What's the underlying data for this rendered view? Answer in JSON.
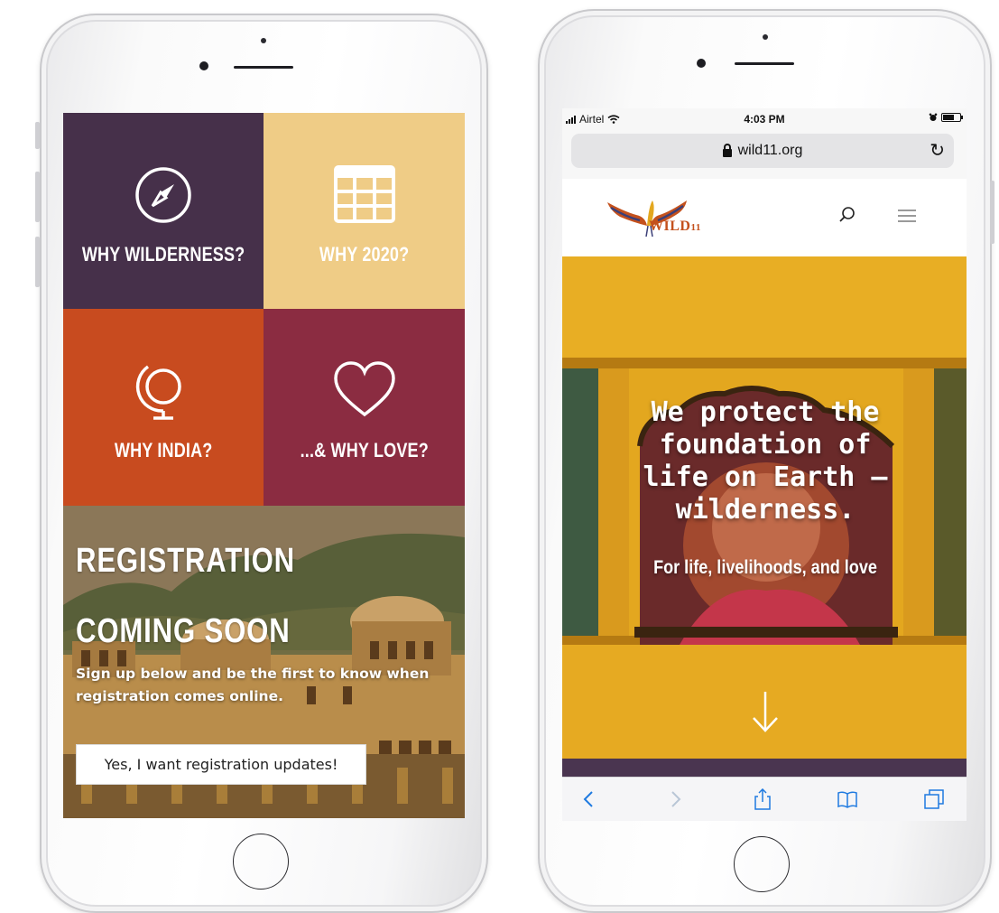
{
  "left_phone": {
    "tiles": [
      {
        "label": "WHY WILDERNESS?",
        "icon": "compass-icon",
        "color": "#46304a"
      },
      {
        "label": "WHY 2020?",
        "icon": "calendar-grid-icon",
        "color": "#efcc86"
      },
      {
        "label": "WHY INDIA?",
        "icon": "globe-icon",
        "color": "#c84b1f"
      },
      {
        "label": "...& WHY LOVE?",
        "icon": "heart-icon",
        "color": "#8b2c41"
      }
    ],
    "registration": {
      "title": "REGISTRATION COMING SOON",
      "subtitle": "Sign up below and be the first to know when registration comes online.",
      "button_label": "Yes, I want registration updates!"
    }
  },
  "right_phone": {
    "status_bar": {
      "carrier": "Airtel",
      "time": "4:03 PM"
    },
    "url": "wild11.org",
    "logo_text": "WILD",
    "logo_suffix": "11",
    "hero": {
      "title": "We protect the foundation of life on Earth – wilderness.",
      "subtitle": "For life, livelihoods, and love",
      "background_color": "#e3a71f"
    },
    "toolbar_icons": [
      "back-icon",
      "forward-icon",
      "share-icon",
      "bookmarks-icon",
      "tabs-icon"
    ],
    "accent": "#1f7ae0"
  }
}
